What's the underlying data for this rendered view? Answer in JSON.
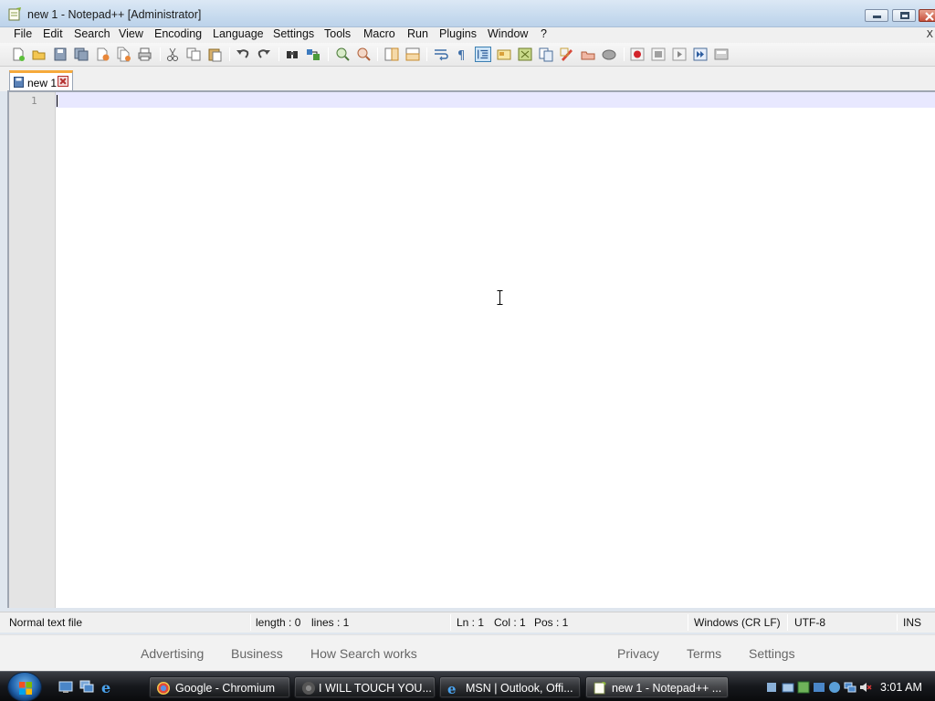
{
  "window": {
    "title": "new 1 - Notepad++ [Administrator]"
  },
  "menu": {
    "items": [
      {
        "label": "File"
      },
      {
        "label": "Edit"
      },
      {
        "label": "Search"
      },
      {
        "label": "View"
      },
      {
        "label": "Encoding"
      },
      {
        "label": "Language"
      },
      {
        "label": "Settings"
      },
      {
        "label": "Tools"
      },
      {
        "label": "Macro"
      },
      {
        "label": "Run"
      },
      {
        "label": "Plugins"
      },
      {
        "label": "Window"
      },
      {
        "label": "?"
      }
    ],
    "close_glyph": "X"
  },
  "toolbar": {
    "icons": [
      "new-file-icon",
      "open-file-icon",
      "save-icon",
      "save-all-icon",
      "close-icon",
      "close-all-icon",
      "print-icon",
      "cut-icon",
      "copy-icon",
      "paste-icon",
      "undo-icon",
      "redo-icon",
      "find-icon",
      "replace-icon",
      "zoom-in-icon",
      "zoom-out-icon",
      "sync-vertical-icon",
      "sync-horizontal-icon",
      "word-wrap-icon",
      "show-all-characters-icon",
      "indent-guide-icon",
      "user-defined-language-icon",
      "document-map-icon",
      "function-list-icon",
      "folder-as-workspace-icon",
      "monitoring-icon",
      "macro-record-icon",
      "macro-start-record-icon",
      "macro-stop-icon",
      "macro-play-icon",
      "macro-run-multiple-icon",
      "macro-save-icon"
    ]
  },
  "tabs": [
    {
      "label": "new 1"
    }
  ],
  "editor": {
    "line_numbers": [
      "1"
    ],
    "content": ""
  },
  "status": {
    "file_type": "Normal text file",
    "length": "length : 0",
    "lines": "lines : 1",
    "ln": "Ln : 1",
    "col": "Col : 1",
    "pos": "Pos : 1",
    "eol": "Windows (CR LF)",
    "encoding": "UTF-8",
    "mode": "INS"
  },
  "web_footer": {
    "links": [
      "Advertising",
      "Business",
      "How Search works",
      "Privacy",
      "Terms",
      "Settings"
    ]
  },
  "taskbar": {
    "buttons": [
      {
        "label": "Google - Chromium",
        "icon": "chromium-icon"
      },
      {
        "label": "I WILL TOUCH YOU...",
        "icon": "chromium-icon"
      },
      {
        "label": "MSN | Outlook, Offi...",
        "icon": "internet-explorer-icon"
      },
      {
        "label": "new 1 - Notepad++ ...",
        "icon": "notepad-plus-plus-icon"
      }
    ],
    "clock": "3:01 AM"
  },
  "colors": {
    "accent_tab": "#f6a93b",
    "current_line": "#e8e8ff",
    "taskbar": "#16181c"
  }
}
